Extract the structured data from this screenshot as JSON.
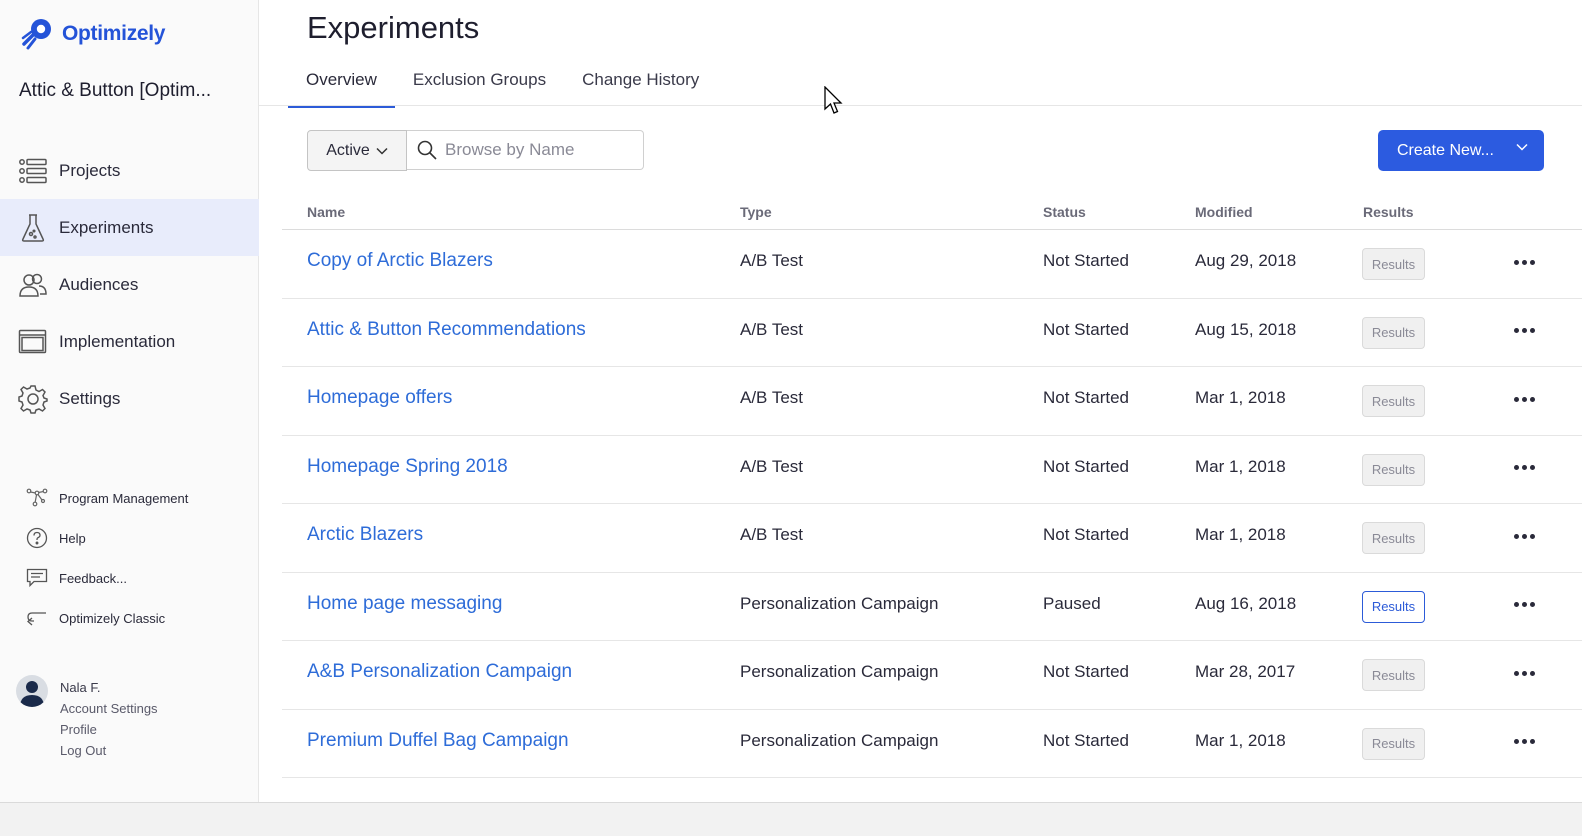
{
  "brand": {
    "name": "Optimizely",
    "color": "#2453d8"
  },
  "account": {
    "name": "Attic & Button [Optim..."
  },
  "nav": [
    {
      "label": "Projects",
      "icon": "list-icon"
    },
    {
      "label": "Experiments",
      "icon": "flask-icon",
      "active": true
    },
    {
      "label": "Audiences",
      "icon": "people-icon"
    },
    {
      "label": "Implementation",
      "icon": "window-icon"
    },
    {
      "label": "Settings",
      "icon": "gear-icon"
    }
  ],
  "secondary_nav": [
    {
      "label": "Program Management",
      "icon": "network-icon"
    },
    {
      "label": "Help",
      "icon": "help-icon"
    },
    {
      "label": "Feedback...",
      "icon": "feedback-icon"
    },
    {
      "label": "Optimizely Classic",
      "icon": "return-icon"
    }
  ],
  "user": {
    "name": "Nala F.",
    "links": [
      "Account Settings",
      "Profile",
      "Log Out"
    ]
  },
  "page": {
    "title": "Experiments",
    "tabs": [
      {
        "label": "Overview",
        "active": true
      },
      {
        "label": "Exclusion Groups"
      },
      {
        "label": "Change History"
      }
    ]
  },
  "filter": {
    "status": "Active",
    "search_placeholder": "Browse by Name"
  },
  "create_button": {
    "label": "Create New..."
  },
  "table": {
    "columns": [
      "Name",
      "Type",
      "Status",
      "Modified",
      "Results"
    ],
    "rows": [
      {
        "name": "Copy of Arctic Blazers",
        "type": "A/B Test",
        "status": "Not Started",
        "modified": "Aug 29, 2018",
        "results": "Results",
        "results_enabled": false
      },
      {
        "name": "Attic & Button Recommendations",
        "type": "A/B Test",
        "status": "Not Started",
        "modified": "Aug 15, 2018",
        "results": "Results",
        "results_enabled": false
      },
      {
        "name": "Homepage offers",
        "type": "A/B Test",
        "status": "Not Started",
        "modified": "Mar 1, 2018",
        "results": "Results",
        "results_enabled": false
      },
      {
        "name": "Homepage Spring 2018",
        "type": "A/B Test",
        "status": "Not Started",
        "modified": "Mar 1, 2018",
        "results": "Results",
        "results_enabled": false
      },
      {
        "name": "Arctic Blazers",
        "type": "A/B Test",
        "status": "Not Started",
        "modified": "Mar 1, 2018",
        "results": "Results",
        "results_enabled": false
      },
      {
        "name": "Home page messaging",
        "type": "Personalization Campaign",
        "status": "Paused",
        "modified": "Aug 16, 2018",
        "results": "Results",
        "results_enabled": true
      },
      {
        "name": "A&B Personalization Campaign",
        "type": "Personalization Campaign",
        "status": "Not Started",
        "modified": "Mar 28, 2017",
        "results": "Results",
        "results_enabled": false
      },
      {
        "name": "Premium Duffel Bag Campaign",
        "type": "Personalization Campaign",
        "status": "Not Started",
        "modified": "Mar 1, 2018",
        "results": "Results",
        "results_enabled": false
      }
    ]
  },
  "colors": {
    "accent": "#2c5be0",
    "link": "#2e6cd8",
    "active_nav_bg": "#e8ecfb"
  }
}
